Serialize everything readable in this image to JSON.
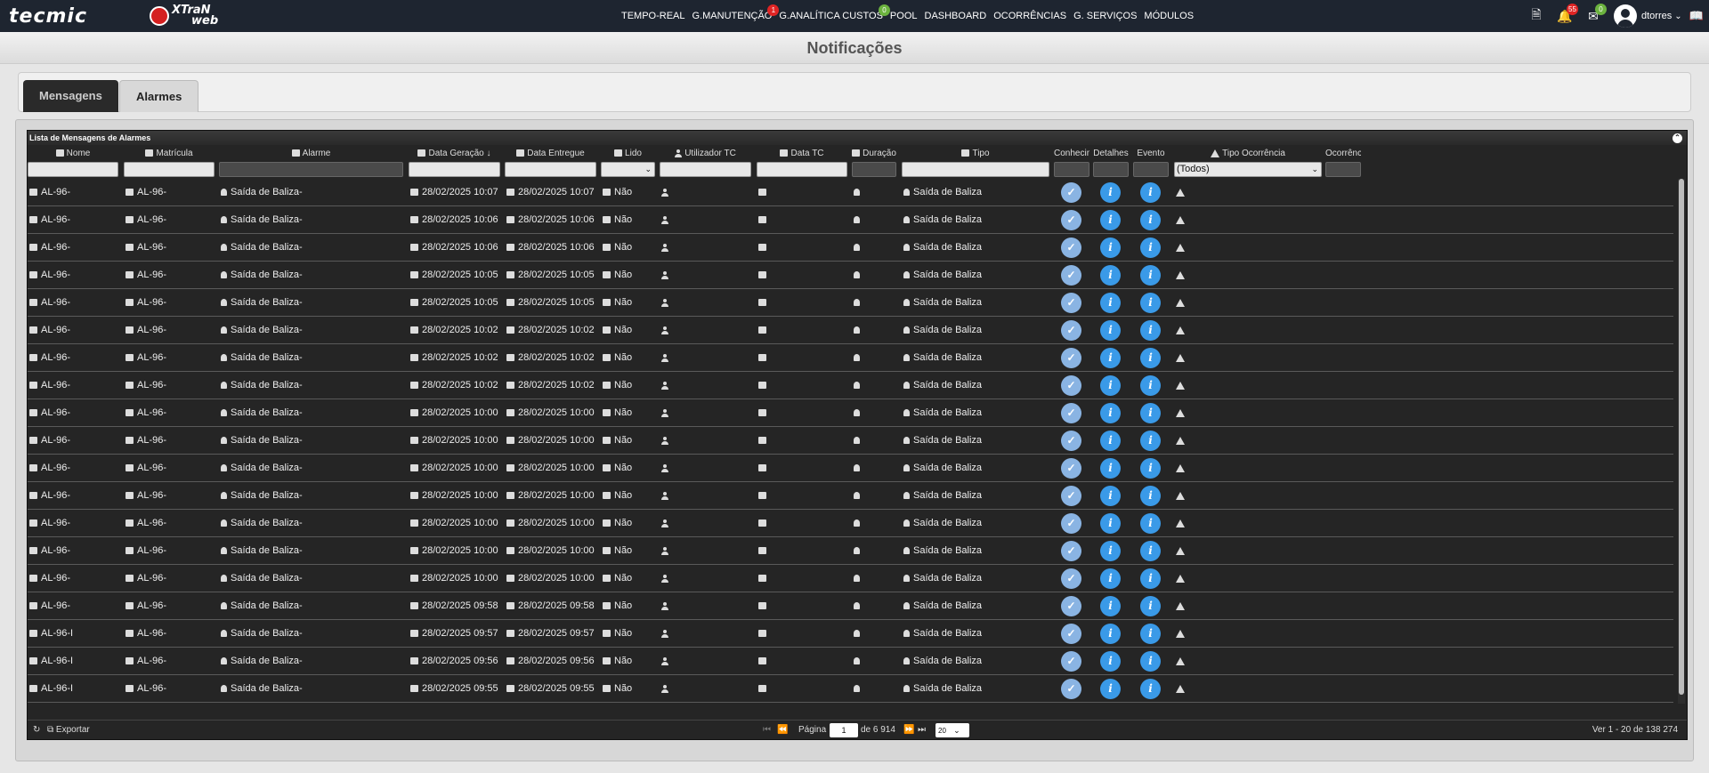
{
  "header": {
    "logo_tecmic": "tecmic",
    "logo_xtran": "XTraN",
    "logo_web": "web",
    "nav": [
      {
        "label": "TEMPO-REAL",
        "badge": ""
      },
      {
        "label": "G.MANUTENÇÃO",
        "badge": "1"
      },
      {
        "label": "G.ANALÍTICA CUSTOS",
        "badge": "0"
      },
      {
        "label": "POOL",
        "badge": ""
      },
      {
        "label": "DASHBOARD",
        "badge": ""
      },
      {
        "label": "OCORRÊNCIAS",
        "badge": ""
      },
      {
        "label": "G. SERVIÇOS",
        "badge": ""
      },
      {
        "label": "MÓDULOS",
        "badge": ""
      }
    ],
    "notifications_badge": "55",
    "messages_badge": "0",
    "username": "dtorres"
  },
  "page_title": "Notificações",
  "tabs": [
    "Mensagens",
    "Alarmes"
  ],
  "grid": {
    "caption": "Lista de Mensagens de Alarmes",
    "columns": [
      "Nome",
      "Matrícula",
      "Alarme",
      "Data Geração",
      "Data Entregue",
      "Lido",
      "Utilizador TC",
      "Data TC",
      "Duração",
      "Tipo",
      "Conhecime",
      "Detalhes",
      "Evento",
      "Tipo Ocorrência",
      "Ocorrências"
    ],
    "tipo_ocorrencia_filter": "(Todos)",
    "rows": [
      {
        "nome": "AL-96-",
        "matricula": "AL-96-",
        "alarme": "Saída de Baliza-",
        "data_geracao": "28/02/2025 10:07",
        "data_entregue": "28/02/2025 10:07",
        "lido": "Não",
        "tipo": "Saída de Baliza"
      },
      {
        "nome": "AL-96-",
        "matricula": "AL-96-",
        "alarme": "Saída de Baliza-",
        "data_geracao": "28/02/2025 10:06",
        "data_entregue": "28/02/2025 10:06",
        "lido": "Não",
        "tipo": "Saída de Baliza"
      },
      {
        "nome": "AL-96-",
        "matricula": "AL-96-",
        "alarme": "Saída de Baliza-",
        "data_geracao": "28/02/2025 10:06",
        "data_entregue": "28/02/2025 10:06",
        "lido": "Não",
        "tipo": "Saída de Baliza"
      },
      {
        "nome": "AL-96-",
        "matricula": "AL-96-",
        "alarme": "Saída de Baliza-",
        "data_geracao": "28/02/2025 10:05",
        "data_entregue": "28/02/2025 10:05",
        "lido": "Não",
        "tipo": "Saída de Baliza"
      },
      {
        "nome": "AL-96-",
        "matricula": "AL-96-",
        "alarme": "Saída de Baliza-",
        "data_geracao": "28/02/2025 10:05",
        "data_entregue": "28/02/2025 10:05",
        "lido": "Não",
        "tipo": "Saída de Baliza"
      },
      {
        "nome": "AL-96-",
        "matricula": "AL-96-",
        "alarme": "Saída de Baliza-",
        "data_geracao": "28/02/2025 10:02",
        "data_entregue": "28/02/2025 10:02",
        "lido": "Não",
        "tipo": "Saída de Baliza"
      },
      {
        "nome": "AL-96-",
        "matricula": "AL-96-",
        "alarme": "Saída de Baliza-",
        "data_geracao": "28/02/2025 10:02",
        "data_entregue": "28/02/2025 10:02",
        "lido": "Não",
        "tipo": "Saída de Baliza"
      },
      {
        "nome": "AL-96-",
        "matricula": "AL-96-",
        "alarme": "Saída de Baliza-",
        "data_geracao": "28/02/2025 10:02",
        "data_entregue": "28/02/2025 10:02",
        "lido": "Não",
        "tipo": "Saída de Baliza"
      },
      {
        "nome": "AL-96-",
        "matricula": "AL-96-",
        "alarme": "Saída de Baliza-",
        "data_geracao": "28/02/2025 10:00",
        "data_entregue": "28/02/2025 10:00",
        "lido": "Não",
        "tipo": "Saída de Baliza"
      },
      {
        "nome": "AL-96-",
        "matricula": "AL-96-",
        "alarme": "Saída de Baliza-",
        "data_geracao": "28/02/2025 10:00",
        "data_entregue": "28/02/2025 10:00",
        "lido": "Não",
        "tipo": "Saída de Baliza"
      },
      {
        "nome": "AL-96-",
        "matricula": "AL-96-",
        "alarme": "Saída de Baliza-",
        "data_geracao": "28/02/2025 10:00",
        "data_entregue": "28/02/2025 10:00",
        "lido": "Não",
        "tipo": "Saída de Baliza"
      },
      {
        "nome": "AL-96-",
        "matricula": "AL-96-",
        "alarme": "Saída de Baliza-",
        "data_geracao": "28/02/2025 10:00",
        "data_entregue": "28/02/2025 10:00",
        "lido": "Não",
        "tipo": "Saída de Baliza"
      },
      {
        "nome": "AL-96-",
        "matricula": "AL-96-",
        "alarme": "Saída de Baliza-",
        "data_geracao": "28/02/2025 10:00",
        "data_entregue": "28/02/2025 10:00",
        "lido": "Não",
        "tipo": "Saída de Baliza"
      },
      {
        "nome": "AL-96-",
        "matricula": "AL-96-",
        "alarme": "Saída de Baliza-",
        "data_geracao": "28/02/2025 10:00",
        "data_entregue": "28/02/2025 10:00",
        "lido": "Não",
        "tipo": "Saída de Baliza"
      },
      {
        "nome": "AL-96-",
        "matricula": "AL-96-",
        "alarme": "Saída de Baliza-",
        "data_geracao": "28/02/2025 10:00",
        "data_entregue": "28/02/2025 10:00",
        "lido": "Não",
        "tipo": "Saída de Baliza"
      },
      {
        "nome": "AL-96-",
        "matricula": "AL-96-",
        "alarme": "Saída de Baliza-",
        "data_geracao": "28/02/2025 09:58",
        "data_entregue": "28/02/2025 09:58",
        "lido": "Não",
        "tipo": "Saída de Baliza"
      },
      {
        "nome": "AL-96-I",
        "matricula": "AL-96-",
        "alarme": "Saída de Baliza-",
        "data_geracao": "28/02/2025 09:57",
        "data_entregue": "28/02/2025 09:57",
        "lido": "Não",
        "tipo": "Saída de Baliza"
      },
      {
        "nome": "AL-96-I",
        "matricula": "AL-96-",
        "alarme": "Saída de Baliza-",
        "data_geracao": "28/02/2025 09:56",
        "data_entregue": "28/02/2025 09:56",
        "lido": "Não",
        "tipo": "Saída de Baliza"
      },
      {
        "nome": "AL-96-I",
        "matricula": "AL-96-",
        "alarme": "Saída de Baliza-",
        "data_geracao": "28/02/2025 09:55",
        "data_entregue": "28/02/2025 09:55",
        "lido": "Não",
        "tipo": "Saída de Baliza"
      }
    ]
  },
  "footer": {
    "export": "Exportar",
    "page_label": "Página",
    "page_value": "1",
    "of_pages": "de 6 914",
    "page_size": "20",
    "summary": "Ver 1 - 20 de 138 274"
  },
  "colors": {
    "topbar": "#1e2530",
    "grid_bg": "#252525",
    "info_blue": "#3a9ae8",
    "check_blue": "#8ab4e3",
    "badge_red": "#e02424",
    "badge_green": "#6cb33f"
  }
}
